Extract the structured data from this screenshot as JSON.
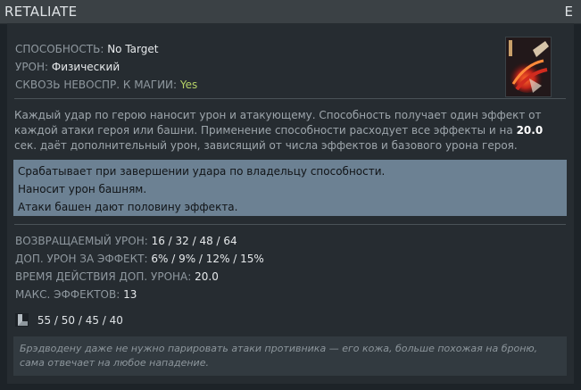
{
  "title": "RETALIATE",
  "hotkey": "E",
  "properties": [
    {
      "label": "СПОСОБНОСТЬ:",
      "value": "No Target"
    },
    {
      "label": "УРОН:",
      "value": "Физический"
    },
    {
      "label": "СКВОЗЬ НЕВОСПР. К МАГИИ:",
      "value": "Yes"
    }
  ],
  "icon": "retaliate-ability-icon",
  "description": {
    "part1": "Каждый удар по герою наносит урон и атакующему. Способность получает один эффект от каждой атаки героя или башни. Применение способности расходует все эффекты и на",
    "highlight": "20.0",
    "part2": "сек. даёт дополнительный урон, зависящий от числа эффектов и базового урона героя."
  },
  "notes": [
    "Срабатывает при завершении удара по владельцу способности.",
    "Наносит урон башням.",
    "Атаки башен дают половину эффекта."
  ],
  "stats": [
    {
      "label": "ВОЗВРАЩАЕМЫЙ УРОН:",
      "value": "16 / 32 / 48 / 64"
    },
    {
      "label": "ДОП. УРОН ЗА ЭФФЕКТ:",
      "value": "6% / 9% / 12% / 15%"
    },
    {
      "label": "ВРЕМЯ ДЕЙСТВИЯ ДОП. УРОНА:",
      "value": "20.0"
    },
    {
      "label": "МАКС. ЭФФЕКТОВ:",
      "value": "13"
    }
  ],
  "cooldown": {
    "icon": "cooldown-icon",
    "value": "55 / 50 / 45 / 40"
  },
  "lore": "Брэдводену даже не нужно парировать атаки противника — его кожа, больше похожая на броню, сама отвечает на любое нападение.",
  "colors": {
    "yes": "#b4d166",
    "notes_bg": "#6c8193"
  }
}
